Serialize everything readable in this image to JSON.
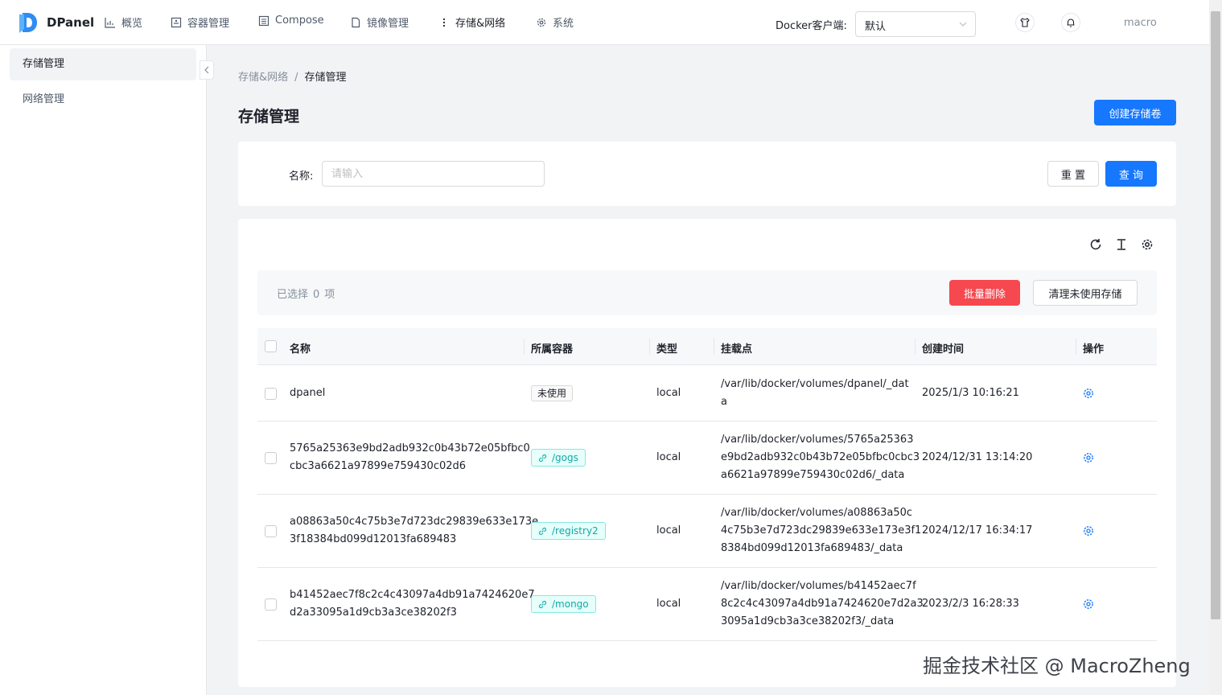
{
  "app": {
    "name": "DPanel"
  },
  "nav": [
    {
      "label": "概览",
      "icon": "chart-icon"
    },
    {
      "label": "容器管理",
      "icon": "container-icon"
    },
    {
      "label": "Compose",
      "icon": "compose-icon"
    },
    {
      "label": "镜像管理",
      "icon": "file-icon"
    },
    {
      "label": "存储&网络",
      "icon": "more-icon"
    },
    {
      "label": "系统",
      "icon": "gear-icon"
    }
  ],
  "client": {
    "label": "Docker客户端:",
    "value": "默认"
  },
  "user": "macro",
  "sidebar": [
    {
      "label": "存储管理",
      "active": true
    },
    {
      "label": "网络管理",
      "active": false
    }
  ],
  "breadcrumb": [
    "存储&网络",
    "/",
    "存储管理"
  ],
  "page": {
    "title": "存储管理",
    "create_button": "创建存储卷"
  },
  "search": {
    "label": "名称:",
    "placeholder": "请输入",
    "reset": "重 置",
    "query": "查 询"
  },
  "selection": {
    "prefix": "已选择",
    "count": "0",
    "suffix": "项",
    "batch_delete": "批量删除",
    "clean_unused": "清理未使用存储"
  },
  "table": {
    "headers": [
      "名称",
      "所属容器",
      "类型",
      "挂载点",
      "创建时间",
      "操作"
    ],
    "rows": [
      {
        "name": [
          "dpanel"
        ],
        "container": "未使用",
        "container_type": "unused",
        "type": "local",
        "mount": [
          "/var/lib/docker/volumes/dpanel/_dat",
          "a"
        ],
        "created": "2025/1/3 10:16:21"
      },
      {
        "name": [
          "5765a25363e9bd2adb932c0b43b72e05bfbc0",
          "cbc3a6621a97899e759430c02d6"
        ],
        "container": "/gogs",
        "container_type": "link",
        "type": "local",
        "mount": [
          "/var/lib/docker/volumes/5765a25363",
          "e9bd2adb932c0b43b72e05bfbc0cbc3",
          "a6621a97899e759430c02d6/_data"
        ],
        "created": "2024/12/31 13:14:20"
      },
      {
        "name": [
          "a08863a50c4c75b3e7d723dc29839e633e173e",
          "3f18384bd099d12013fa689483"
        ],
        "container": "/registry2",
        "container_type": "link",
        "type": "local",
        "mount": [
          "/var/lib/docker/volumes/a08863a50c",
          "4c75b3e7d723dc29839e633e173e3f1",
          "8384bd099d12013fa689483/_data"
        ],
        "created": "2024/12/17 16:34:17"
      },
      {
        "name": [
          "b41452aec7f8c2c4c43097a4db91a7424620e7",
          "d2a33095a1d9cb3a3ce38202f3"
        ],
        "container": "/mongo",
        "container_type": "link",
        "type": "local",
        "mount": [
          "/var/lib/docker/volumes/b41452aec7f",
          "8c2c4c43097a4db91a7424620e7d2a3",
          "3095a1d9cb3a3ce38202f3/_data"
        ],
        "created": "2023/2/3 16:28:33"
      }
    ]
  },
  "watermark": "掘金技术社区 @ MacroZheng",
  "colors": {
    "primary": "#1677ff",
    "danger": "#f5484f",
    "link_tag": "#13a8a8"
  }
}
